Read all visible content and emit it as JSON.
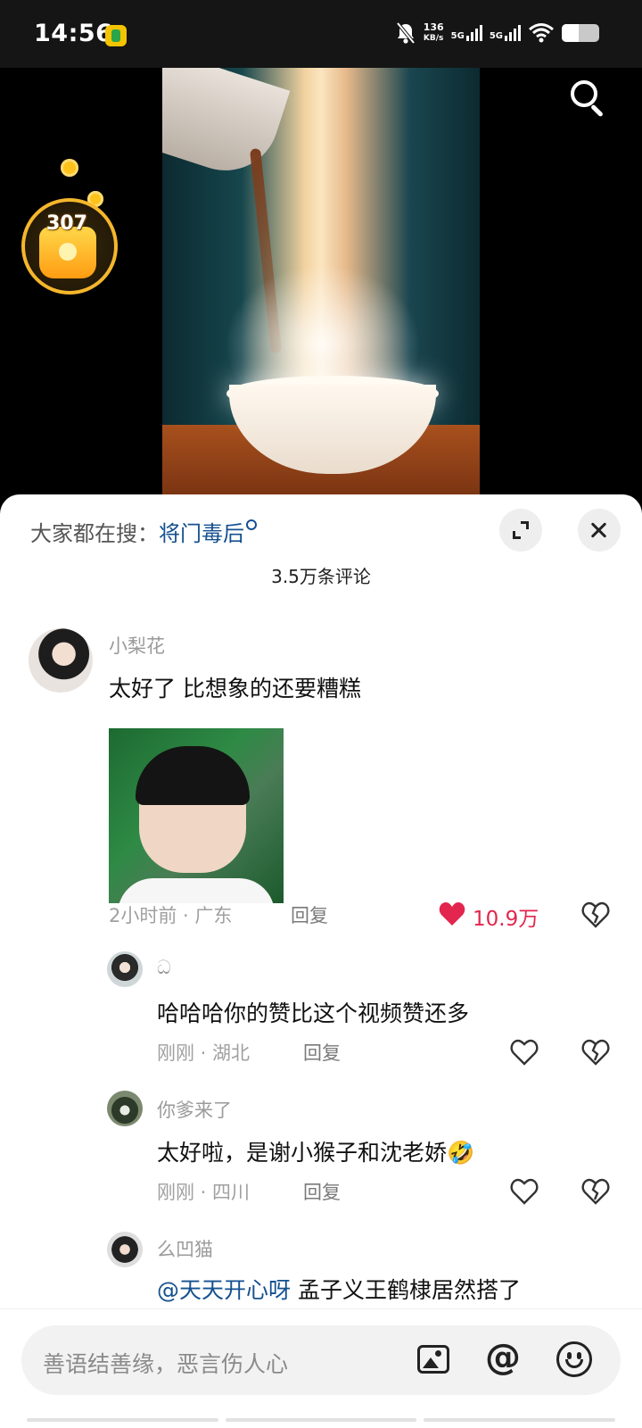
{
  "status_bar": {
    "time": "14:56",
    "net_speed_value": "136",
    "net_speed_unit": "KB/s",
    "sim1": "5G",
    "sim2": "5G",
    "icons": [
      "app-notification-icon",
      "mute-bell-icon",
      "signal-icon",
      "wifi-icon",
      "battery-icon"
    ],
    "battery_level": 0.45
  },
  "video": {
    "coin_count": "307",
    "icons": [
      "search-icon",
      "coin-bag-icon"
    ]
  },
  "comments_panel": {
    "hot_search_prefix": "大家都在搜：",
    "hot_search_keyword": "将门毒后",
    "comment_count": "3.5万条评论",
    "icons": [
      "expand-icon",
      "close-icon"
    ]
  },
  "comments": [
    {
      "user": "小梨花",
      "text": "太好了 比想象的还要糟糕",
      "time": "2小时前",
      "location": "广东",
      "reply_label": "回复",
      "likes": "10.9万",
      "liked": true,
      "has_image": true
    }
  ],
  "replies": [
    {
      "user": "ධ",
      "text": "哈哈哈你的赞比这个视频赞还多",
      "time": "刚刚",
      "location": "湖北",
      "reply_label": "回复"
    },
    {
      "user": "你爹来了",
      "text": "太好啦，是谢小猴子和沈老娇",
      "emoji": "🤣",
      "time": "刚刚",
      "location": "四川",
      "reply_label": "回复"
    },
    {
      "user": "么凹猫",
      "mention": "@天天开心呀",
      "text": " 孟子义王鹤棣居然搭了"
    }
  ],
  "separator": " · ",
  "input_bar": {
    "placeholder": "善语结善缘，恶言伤人心",
    "at_symbol": "@",
    "icons": [
      "image-icon",
      "at-icon",
      "emoji-icon"
    ]
  },
  "colors": {
    "link": "#14508f",
    "like": "#e2264d"
  }
}
